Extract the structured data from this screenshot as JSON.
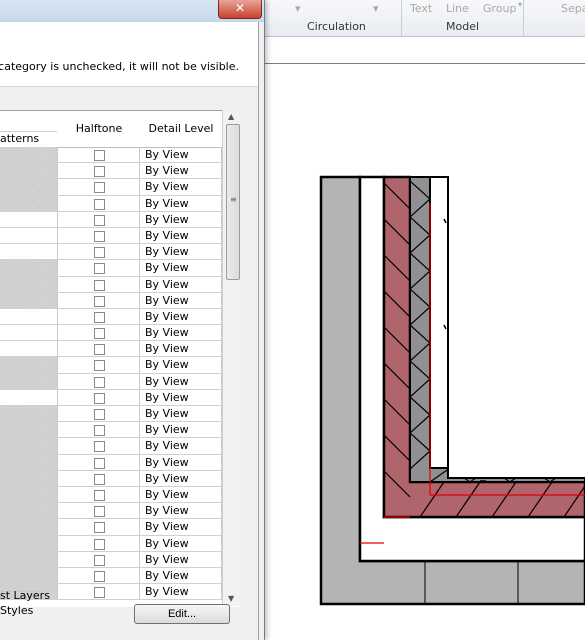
{
  "ribbon": {
    "items": [
      "Text",
      "Line",
      "Group",
      "Sepa"
    ],
    "panels": [
      "Circulation",
      "Model"
    ]
  },
  "dialog": {
    "close_glyph": "✕",
    "info_text": "If a category is unchecked, it will not be visible.",
    "columns": {
      "patterns": "atterns",
      "halftone": "Halftone",
      "detail_level": "Detail Level"
    },
    "rows": [
      {
        "shade": true,
        "detail": "By View"
      },
      {
        "shade": true,
        "detail": "By View"
      },
      {
        "shade": true,
        "detail": "By View"
      },
      {
        "shade": true,
        "detail": "By View"
      },
      {
        "shade": false,
        "detail": "By View"
      },
      {
        "shade": false,
        "detail": "By View"
      },
      {
        "shade": false,
        "detail": "By View"
      },
      {
        "shade": true,
        "detail": "By View"
      },
      {
        "shade": true,
        "detail": "By View"
      },
      {
        "shade": true,
        "detail": "By View"
      },
      {
        "shade": false,
        "detail": "By View"
      },
      {
        "shade": false,
        "detail": "By View"
      },
      {
        "shade": false,
        "detail": "By View"
      },
      {
        "shade": true,
        "detail": "By View"
      },
      {
        "shade": true,
        "detail": "By View"
      },
      {
        "shade": false,
        "detail": "By View"
      },
      {
        "shade": true,
        "detail": "By View"
      },
      {
        "shade": true,
        "detail": "By View"
      },
      {
        "shade": true,
        "detail": "By View"
      },
      {
        "shade": true,
        "detail": "By View"
      },
      {
        "shade": true,
        "detail": "By View"
      },
      {
        "shade": true,
        "detail": "By View"
      },
      {
        "shade": true,
        "detail": "By View"
      },
      {
        "shade": true,
        "detail": "By View"
      },
      {
        "shade": true,
        "detail": "By View"
      },
      {
        "shade": true,
        "detail": "By View"
      },
      {
        "shade": true,
        "detail": "By View"
      },
      {
        "shade": true,
        "detail": "By View"
      }
    ],
    "bottom": {
      "layers_label": "st Layers",
      "styles_label": "Styles",
      "edit_button": "Edit..."
    }
  },
  "colors": {
    "wall_red": "#b0646b",
    "wall_gray": "#b4b4b4",
    "red_line": "#e00000"
  }
}
